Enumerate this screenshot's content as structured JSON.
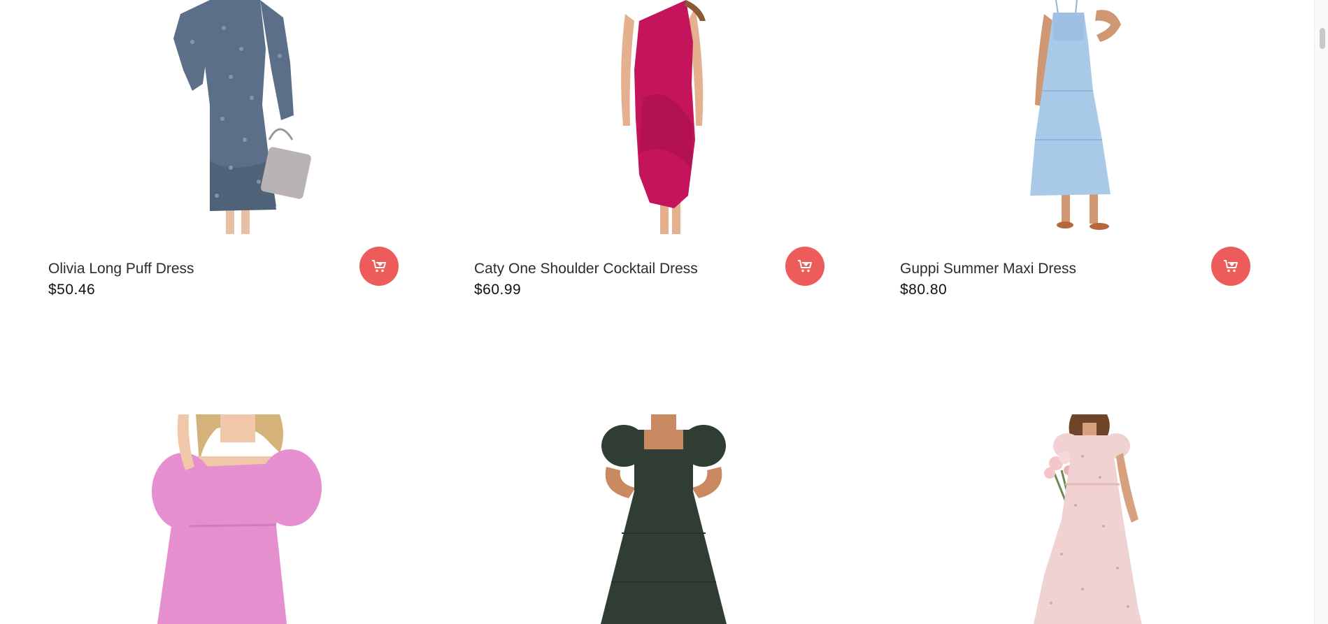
{
  "products": [
    {
      "name": "Olivia Long Puff Dress",
      "price": "$50.46",
      "dress_color": "#5b7088"
    },
    {
      "name": "Caty One Shoulder Cocktail Dress",
      "price": "$60.99",
      "dress_color": "#c4145c"
    },
    {
      "name": "Guppi Summer Maxi Dress",
      "price": "$80.80",
      "dress_color": "#a9c9e8"
    },
    {
      "name": "",
      "price": "",
      "dress_color": "#e58fcf"
    },
    {
      "name": "",
      "price": "",
      "dress_color": "#2f3d33"
    },
    {
      "name": "",
      "price": "",
      "dress_color": "#f1d2d2"
    }
  ],
  "icons": {
    "cart": "cart-heart-icon"
  },
  "colors": {
    "accent": "#ee5b5b"
  }
}
